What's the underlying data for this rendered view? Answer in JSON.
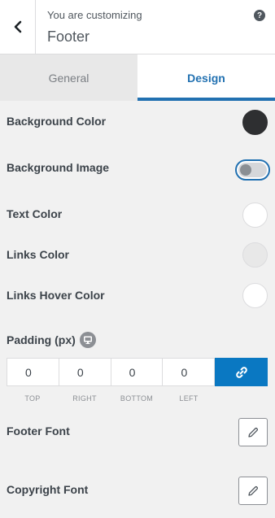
{
  "header": {
    "pre_title": "You are customizing",
    "title": "Footer",
    "help_symbol": "?"
  },
  "tabs": [
    {
      "label": "General",
      "active": false
    },
    {
      "label": "Design",
      "active": true
    }
  ],
  "rows": {
    "background_color": {
      "label": "Background Color",
      "color": "#2e2f31"
    },
    "background_image": {
      "label": "Background Image",
      "enabled": false
    },
    "text_color": {
      "label": "Text Color",
      "color": "#ffffff"
    },
    "links_color": {
      "label": "Links Color",
      "color": "#e8e8e8"
    },
    "links_hover_color": {
      "label": "Links Hover Color",
      "color": "#ffffff"
    }
  },
  "padding": {
    "label": "Padding (px)",
    "fields": [
      {
        "value": "0",
        "label": "TOP"
      },
      {
        "value": "0",
        "label": "RIGHT"
      },
      {
        "value": "0",
        "label": "BOTTOM"
      },
      {
        "value": "0",
        "label": "LEFT"
      }
    ],
    "linked": true
  },
  "fonts": {
    "footer_font": {
      "label": "Footer Font"
    },
    "copyright_font": {
      "label": "Copyright Font"
    }
  },
  "colors": {
    "accent": "#2271b1",
    "link_button": "#0a78c2"
  },
  "icons": {
    "back": "chevron-left-icon",
    "help": "help-icon",
    "device": "desktop-icon",
    "link": "link-icon",
    "edit": "pencil-icon"
  }
}
